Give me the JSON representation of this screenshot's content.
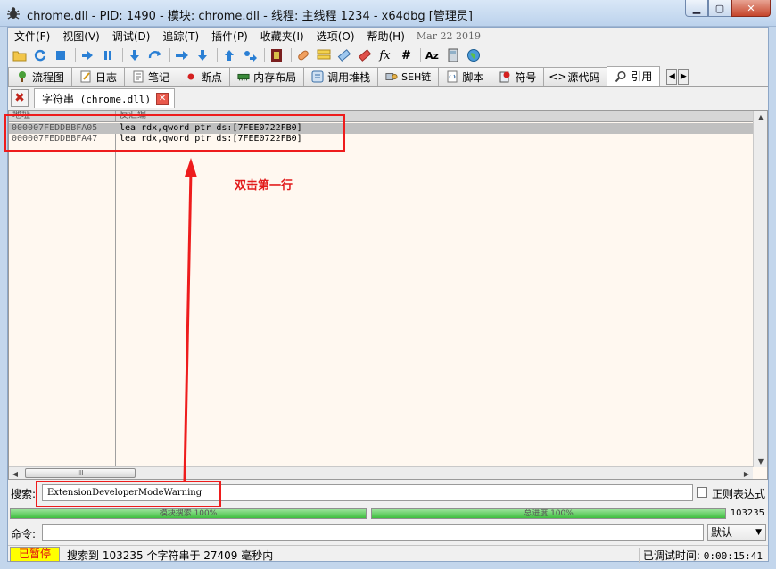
{
  "window": {
    "title": "chrome.dll - PID: 1490 - 模块: chrome.dll - 线程: 主线程 1234 - x64dbg [管理员]",
    "minimize_icon": "minimize-icon",
    "maximize_icon": "maximize-icon",
    "close_icon": "close-icon"
  },
  "menu": {
    "items": [
      "文件(F)",
      "视图(V)",
      "调试(D)",
      "追踪(T)",
      "插件(P)",
      "收藏夹(I)",
      "选项(O)",
      "帮助(H)"
    ],
    "date": "Mar 22 2019"
  },
  "toolbar": {
    "buttons": [
      "open-icon",
      "restart-icon",
      "stop-icon",
      "run-icon",
      "pause-icon",
      "step-into-icon",
      "step-over-icon",
      "trace-into-icon",
      "trace-over-icon",
      "execute-till-return-icon",
      "run-to-user-code-icon",
      "scylla-icon",
      "patch-icon",
      "comment-icon",
      "label-icon",
      "bookmark-icon",
      "function-icon",
      "hash-icon",
      "font-icon",
      "calculator-icon",
      "globe-icon"
    ]
  },
  "tabs": [
    {
      "label": "流程图",
      "icon": "cpu-icon"
    },
    {
      "label": "日志",
      "icon": "log-icon"
    },
    {
      "label": "笔记",
      "icon": "notes-icon"
    },
    {
      "label": "断点",
      "icon": "breakpoint-icon"
    },
    {
      "label": "内存布局",
      "icon": "memory-icon"
    },
    {
      "label": "调用堆栈",
      "icon": "callstack-icon"
    },
    {
      "label": "SEH链",
      "icon": "seh-icon"
    },
    {
      "label": "脚本",
      "icon": "script-icon"
    },
    {
      "label": "符号",
      "icon": "symbol-icon"
    },
    {
      "label": "源代码",
      "icon": "source-icon"
    },
    {
      "label": "引用",
      "icon": "search-icon"
    }
  ],
  "subtab": {
    "label_cjk": "字符串",
    "label_module": "(chrome.dll)"
  },
  "refs": {
    "col_address": "地址",
    "col_disasm": "反汇编",
    "rows": [
      {
        "address": "000007FEDDBBFA05",
        "asm": "lea rdx,qword ptr ds:[7FEE0722FB0]"
      },
      {
        "address": "000007FEDDBBFA47",
        "asm": "lea rdx,qword ptr ds:[7FEE0722FB0]"
      }
    ],
    "hscroll_grip": "III"
  },
  "annotation": {
    "text": "双击第一行",
    "color": "#ee1c1c"
  },
  "search": {
    "label": "搜索:",
    "value": "ExtensionDeveloperModeWarning",
    "regex_label": "正则表达式"
  },
  "progress": {
    "module_label": "模块搜索 100%",
    "module_fraction": 1.0,
    "total_label": "总进度 100%",
    "total_fraction": 1.0,
    "count": "103235"
  },
  "command": {
    "label": "命令:",
    "select_value": "默认"
  },
  "status": {
    "state": "已暂停",
    "message": "搜索到 103235 个字符串于 27409 毫秒内",
    "time_label": "已调试时间:",
    "time_value": "0:00:15:41"
  }
}
